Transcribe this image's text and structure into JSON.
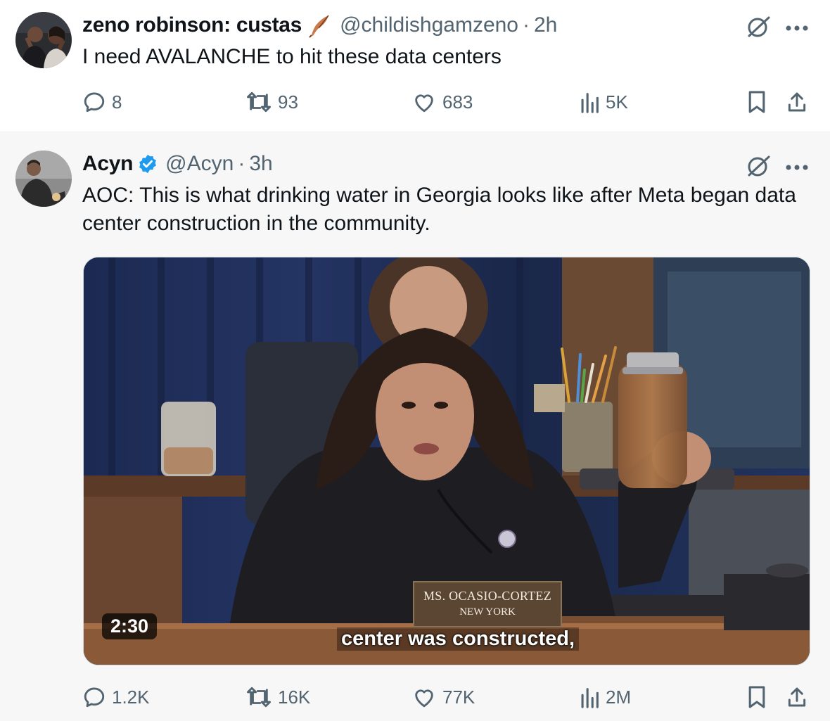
{
  "tweets": [
    {
      "display_name": "zeno robinson: custas",
      "name_emoji": "feather-icon",
      "handle": "@childishgamzeno",
      "separator": "·",
      "time": "2h",
      "text": "I need AVALANCHE to hit these data centers",
      "stats": {
        "replies": "8",
        "reposts": "93",
        "likes": "683",
        "views": "5K"
      }
    },
    {
      "display_name": "Acyn",
      "verified": true,
      "handle": "@Acyn",
      "separator": "·",
      "time": "3h",
      "text": "AOC: This is what drinking water in Georgia looks like after Meta began data center construction in the community.",
      "video": {
        "duration": "2:30",
        "caption": "center was constructed,",
        "placard_name": "MS. OCASIO-CORTEZ",
        "placard_state": "NEW YORK"
      },
      "stats": {
        "replies": "1.2K",
        "reposts": "16K",
        "likes": "77K",
        "views": "2M"
      }
    }
  ],
  "colors": {
    "text_primary": "#0f1419",
    "text_secondary": "#536471",
    "verified_blue": "#1d9bf0",
    "background_alt": "#f7f7f7"
  }
}
